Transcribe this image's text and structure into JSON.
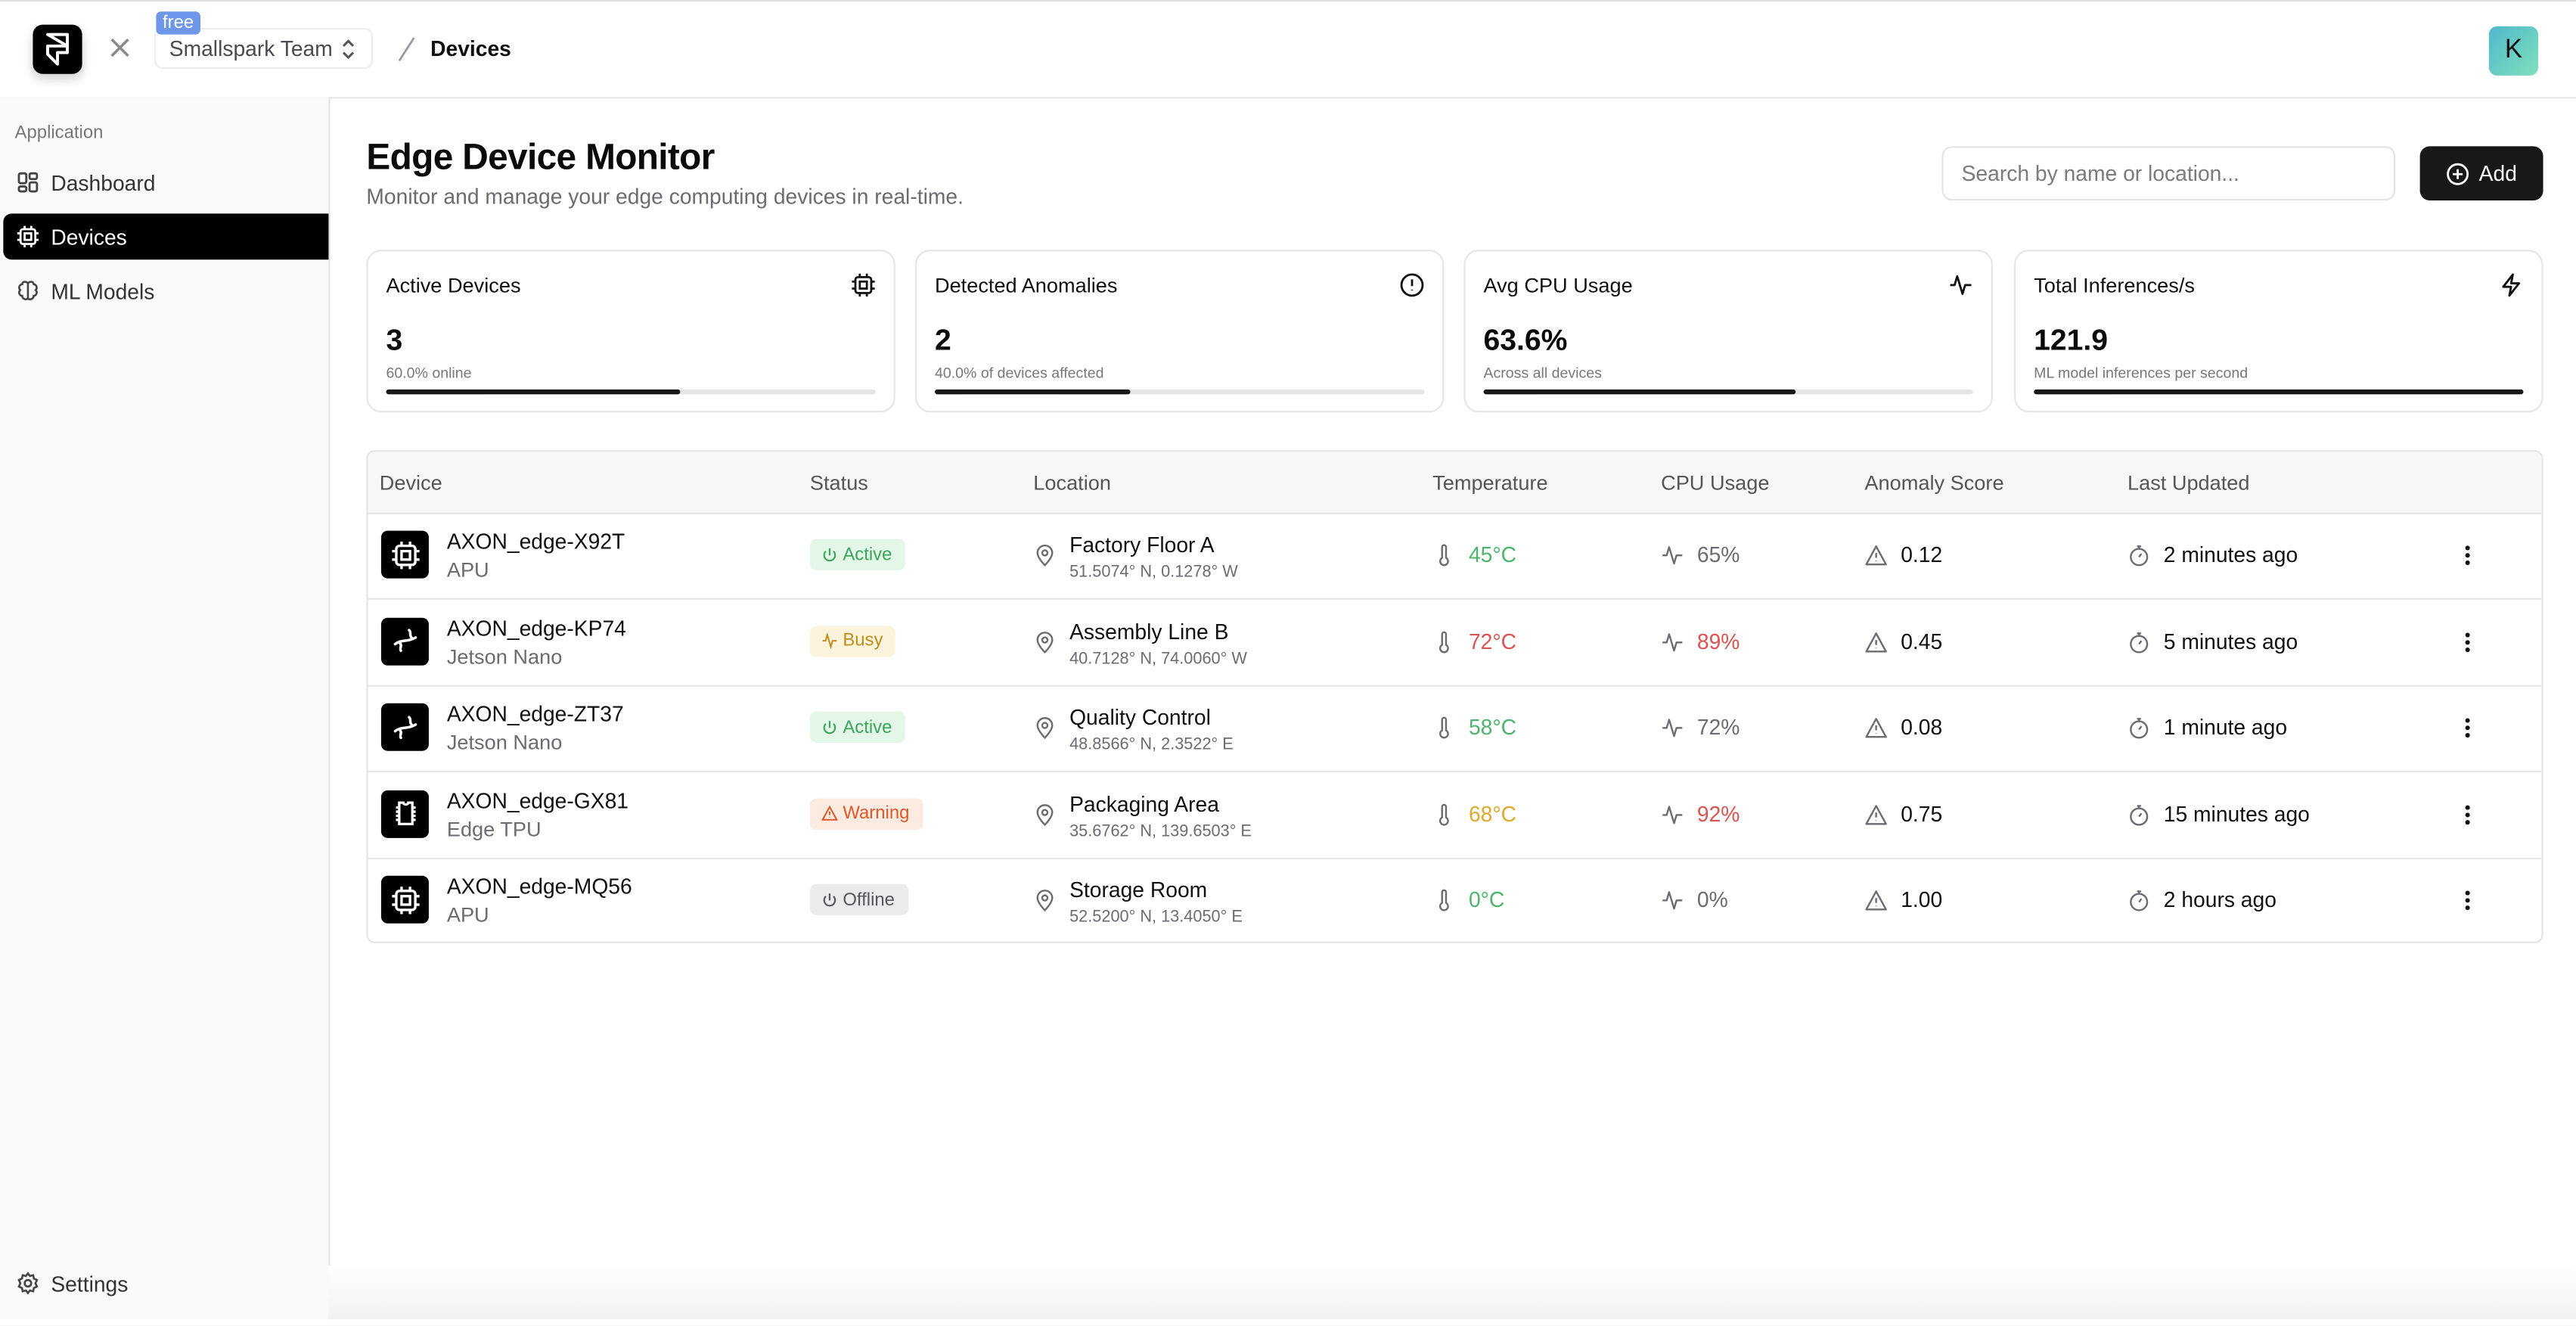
{
  "header": {
    "team_name": "Smallspark Team",
    "plan_badge": "free",
    "breadcrumb_current": "Devices",
    "avatar_initial": "K"
  },
  "sidebar": {
    "section_label": "Application",
    "items": [
      {
        "label": "Dashboard",
        "icon": "layout-dashboard-icon",
        "active": false
      },
      {
        "label": "Devices",
        "icon": "cpu-icon",
        "active": true
      },
      {
        "label": "ML Models",
        "icon": "brain-icon",
        "active": false
      }
    ],
    "settings_label": "Settings"
  },
  "page": {
    "title": "Edge Device Monitor",
    "subtitle": "Monitor and manage your edge computing devices in real-time.",
    "search_placeholder": "Search by name or location...",
    "search_value": "",
    "add_label": "Add"
  },
  "stats": [
    {
      "title": "Active Devices",
      "icon": "cpu-icon",
      "value": "3",
      "sub": "60.0% online",
      "progress": 0.6
    },
    {
      "title": "Detected Anomalies",
      "icon": "alert-circle-icon",
      "value": "2",
      "sub": "40.0% of devices affected",
      "progress": 0.4
    },
    {
      "title": "Avg CPU Usage",
      "icon": "activity-icon",
      "value": "63.6%",
      "sub": "Across all devices",
      "progress": 0.636
    },
    {
      "title": "Total Inferences/s",
      "icon": "zap-icon",
      "value": "121.9",
      "sub": "ML model inferences per second",
      "progress": 1.0
    }
  ],
  "table": {
    "columns": [
      "Device",
      "Status",
      "Location",
      "Temperature",
      "CPU Usage",
      "Anomaly Score",
      "Last Updated"
    ],
    "rows": [
      {
        "name": "AXON_edge-X92T",
        "type": "APU",
        "device_icon": "cpu-icon",
        "status": "Active",
        "status_kind": "active",
        "location": "Factory Floor A",
        "coords": "51.5074° N, 0.1278° W",
        "temperature": "45°C",
        "temp_color": "#4cb56a",
        "cpu": "65%",
        "cpu_color": "#6b6b73",
        "anomaly": "0.12",
        "updated": "2 minutes ago"
      },
      {
        "name": "AXON_edge-KP74",
        "type": "Jetson Nano",
        "device_icon": "jetson-icon",
        "status": "Busy",
        "status_kind": "busy",
        "location": "Assembly Line B",
        "coords": "40.7128° N, 74.0060° W",
        "temperature": "72°C",
        "temp_color": "#d9534f",
        "cpu": "89%",
        "cpu_color": "#d9534f",
        "anomaly": "0.45",
        "updated": "5 minutes ago"
      },
      {
        "name": "AXON_edge-ZT37",
        "type": "Jetson Nano",
        "device_icon": "jetson-icon",
        "status": "Active",
        "status_kind": "active",
        "location": "Quality Control",
        "coords": "48.8566° N, 2.3522° E",
        "temperature": "58°C",
        "temp_color": "#4cb56a",
        "cpu": "72%",
        "cpu_color": "#6b6b73",
        "anomaly": "0.08",
        "updated": "1 minute ago"
      },
      {
        "name": "AXON_edge-GX81",
        "type": "Edge TPU",
        "device_icon": "microchip-icon",
        "status": "Warning",
        "status_kind": "warning",
        "location": "Packaging Area",
        "coords": "35.6762° N, 139.6503° E",
        "temperature": "68°C",
        "temp_color": "#e0a82e",
        "cpu": "92%",
        "cpu_color": "#d9534f",
        "anomaly": "0.75",
        "updated": "15 minutes ago"
      },
      {
        "name": "AXON_edge-MQ56",
        "type": "APU",
        "device_icon": "cpu-icon",
        "status": "Offline",
        "status_kind": "offline",
        "location": "Storage Room",
        "coords": "52.5200° N, 13.4050° E",
        "temperature": "0°C",
        "temp_color": "#4cb56a",
        "cpu": "0%",
        "cpu_color": "#6b6b73",
        "anomaly": "1.00",
        "updated": "2 hours ago"
      }
    ]
  },
  "colors": {
    "status_active_bg": "#e3f6e8",
    "status_active_fg": "#3aa65a",
    "status_busy_bg": "#fbf3dc",
    "status_busy_fg": "#c08e1c",
    "status_warning_bg": "#fcebe1",
    "status_warning_fg": "#e0572a",
    "status_offline_bg": "#ebebed",
    "status_offline_fg": "#55555c",
    "accent_dark": "#18181b"
  }
}
